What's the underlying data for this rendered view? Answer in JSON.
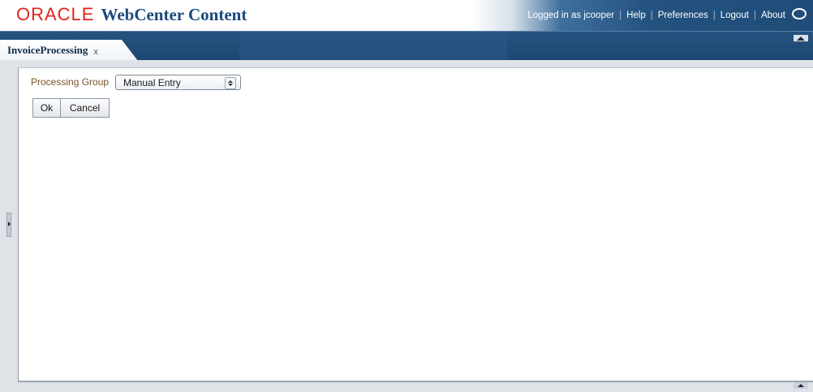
{
  "header": {
    "brand_oracle": "ORACLE",
    "brand_product": "WebCenter Content",
    "logged_in_text": "Logged in as jcooper",
    "links": [
      "Help",
      "Preferences",
      "Logout",
      "About"
    ],
    "help_icon": "speech-bubble-icon"
  },
  "tabs": [
    {
      "label": "InvoiceProcessing",
      "close": "x"
    }
  ],
  "form": {
    "processing_group_label": "Processing Group",
    "processing_group_value": "Manual Entry",
    "ok_label": "Ok",
    "cancel_label": "Cancel"
  },
  "colors": {
    "oracle_red": "#e2231a",
    "brand_blue": "#1b4a7c",
    "header_blue": "#1f4c79",
    "label_brown": "#7a5428"
  }
}
